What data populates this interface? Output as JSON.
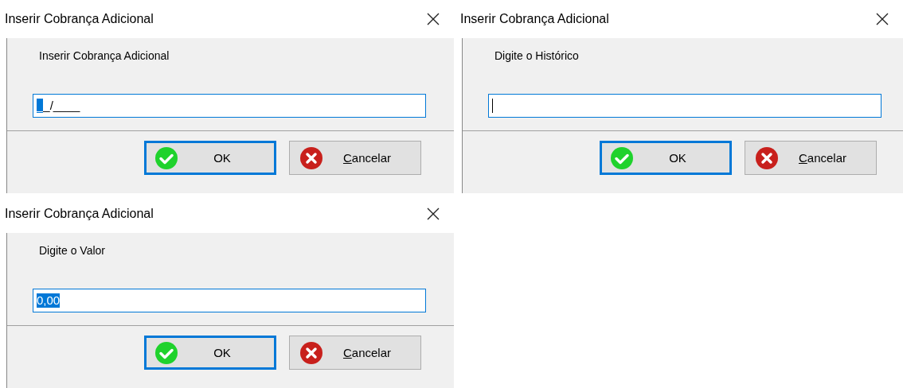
{
  "dialogs": [
    {
      "title": "Inserir Cobrança Adicional",
      "prompt": "Inserir Cobrança Adicional",
      "field": {
        "segments": [
          {
            "text": "_",
            "selected": true
          },
          {
            "text": "_/____",
            "selected": false
          }
        ]
      },
      "buttons": [
        {
          "kind": "ok",
          "label": "OK",
          "focused": true,
          "underline_first": false
        },
        {
          "kind": "cancel",
          "label": "Cancelar",
          "focused": false,
          "underline_first": true
        }
      ]
    },
    {
      "title": "Inserir Cobrança Adicional",
      "prompt": "Digite o Histórico",
      "buttons": [
        {
          "kind": "ok",
          "label": "OK",
          "focused": true,
          "underline_first": false
        },
        {
          "kind": "cancel",
          "label": "Cancelar",
          "focused": false,
          "underline_first": true
        }
      ]
    },
    {
      "title": "Inserir Cobrança Adicional",
      "prompt": "Digite o Valor",
      "field": {
        "segments": [
          {
            "text": "0,00",
            "selected": true
          }
        ]
      },
      "buttons": [
        {
          "kind": "ok",
          "label": "OK",
          "focused": true,
          "underline_first": false
        },
        {
          "kind": "cancel",
          "label": "Cancelar",
          "focused": false,
          "underline_first": true
        }
      ]
    }
  ]
}
